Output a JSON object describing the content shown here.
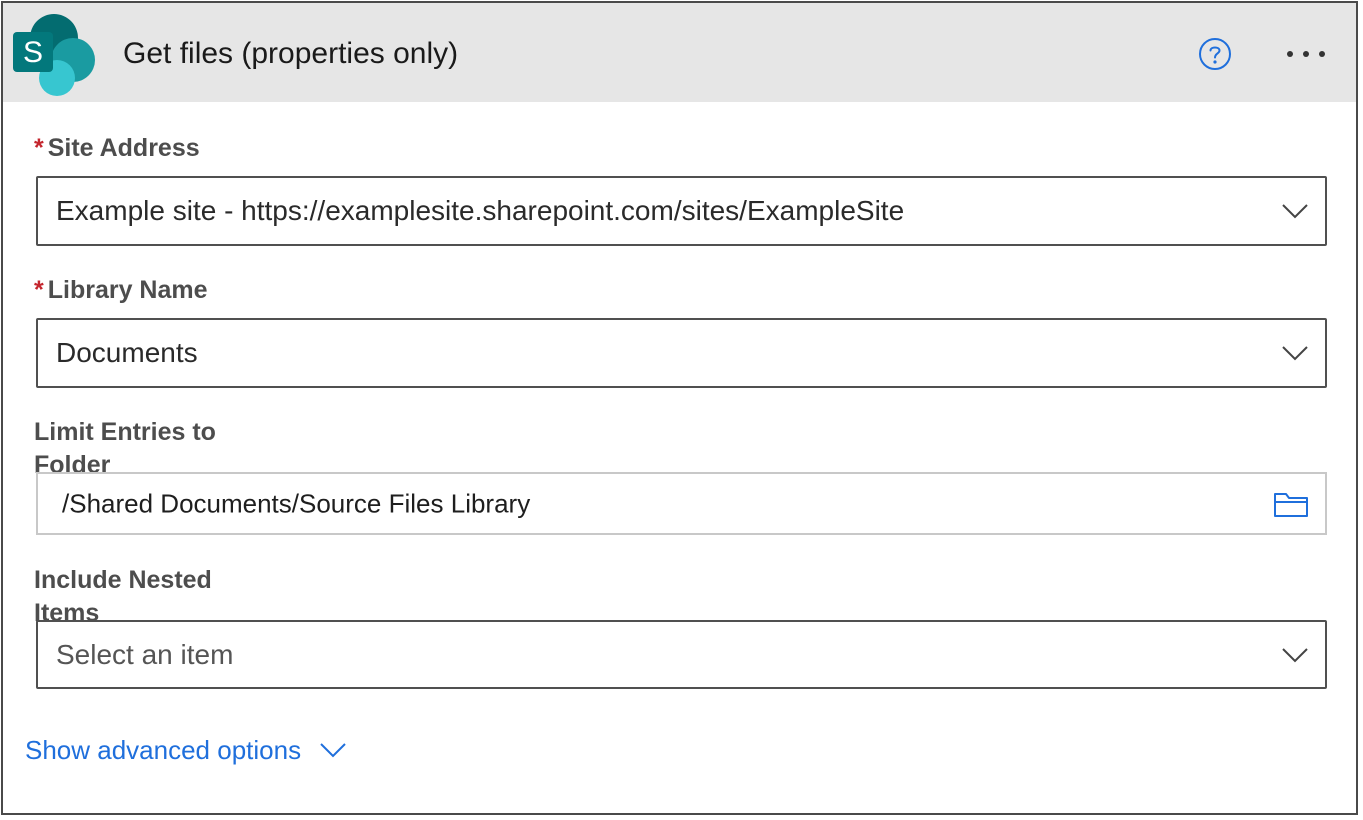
{
  "action": {
    "title": "Get files (properties only)",
    "logo_letter": "S",
    "icons": {
      "logo": "sharepoint-logo-icon",
      "help": "question-circle-icon",
      "more": "ellipsis-icon"
    }
  },
  "fields": {
    "site_address": {
      "required_mark": "*",
      "label": "Site Address",
      "value": "Example site - https://examplesite.sharepoint.com/sites/ExampleSite"
    },
    "library_name": {
      "required_mark": "*",
      "label": "Library Name",
      "value": "Documents"
    },
    "limit_folder": {
      "label": "Limit Entries to Folder",
      "value": "/Shared Documents/Source Files Library"
    },
    "include_nested": {
      "label": "Include Nested Items",
      "placeholder": "Select an item"
    }
  },
  "advanced_options": {
    "label": "Show advanced options"
  },
  "colors": {
    "header_bg": "#e6e6e6",
    "required": "#c4262e",
    "link": "#1f6fdc",
    "help_icon": "#1f6fdc",
    "logo_dark": "#036c70",
    "logo_mid": "#1a9ba1",
    "logo_light": "#37c6d0"
  }
}
